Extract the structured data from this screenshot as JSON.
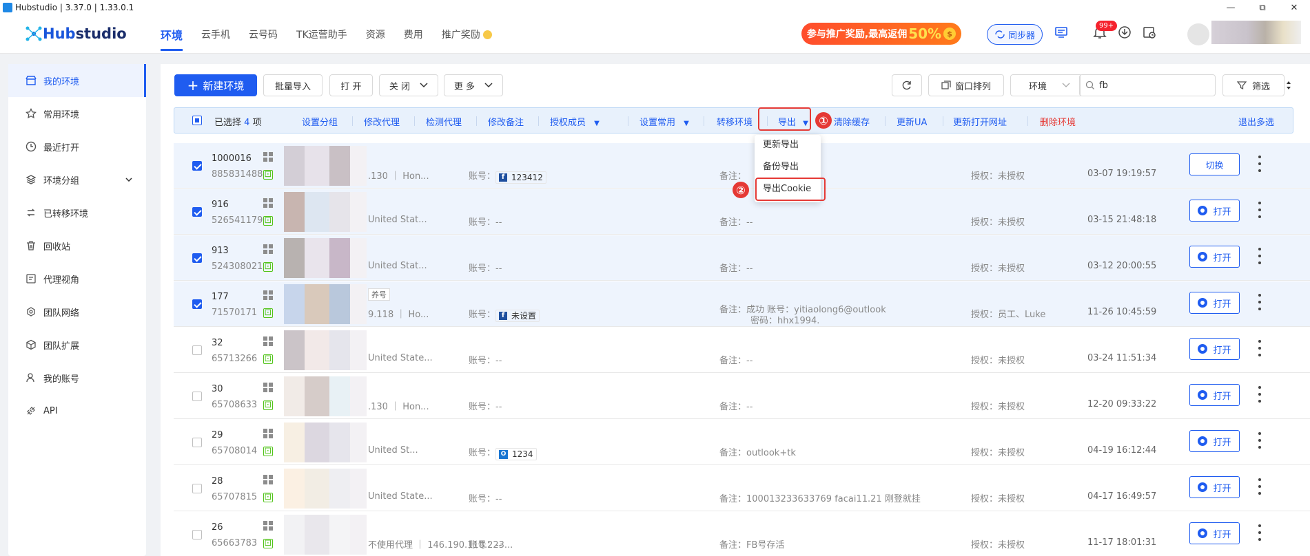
{
  "window": {
    "title": "Hubstudio | 3.37.0 | 1.33.0.1",
    "controls": [
      "—",
      "⧉",
      "✕"
    ]
  },
  "header": {
    "logo": {
      "hub": "Hub",
      "studio": "studio"
    },
    "nav": [
      "环境",
      "云手机",
      "云号码",
      "TK运营助手",
      "资源",
      "费用",
      "推广奖励"
    ],
    "promo": {
      "text": "参与推广奖励,最高返佣",
      "highlight": "50%",
      "coin": "$"
    },
    "sync_label": "同步器",
    "notif_badge": "99+"
  },
  "sidebar": {
    "items": [
      {
        "label": "我的环境",
        "icon": "store-icon"
      },
      {
        "label": "常用环境",
        "icon": "star-icon"
      },
      {
        "label": "最近打开",
        "icon": "clock-icon"
      },
      {
        "label": "环境分组",
        "icon": "layers-icon"
      },
      {
        "label": "已转移环境",
        "icon": "transfer-icon"
      },
      {
        "label": "回收站",
        "icon": "trash-icon"
      },
      {
        "label": "代理视角",
        "icon": "proxy-icon"
      },
      {
        "label": "团队网络",
        "icon": "network-icon"
      },
      {
        "label": "团队扩展",
        "icon": "extension-icon"
      },
      {
        "label": "我的账号",
        "icon": "user-icon"
      },
      {
        "label": "API",
        "icon": "api-icon"
      }
    ]
  },
  "toolbar": {
    "new_env": "新建环境",
    "batch_import": "批量导入",
    "open": "打 开",
    "close": "关 闭",
    "more": "更 多",
    "window_arrange": "窗口排列",
    "env_select": "环境",
    "search_value": "fb",
    "filter": "筛选"
  },
  "selection_bar": {
    "selected_prefix": "已选择",
    "selected_count": "4",
    "selected_suffix": "项",
    "actions": [
      "设置分组",
      "修改代理",
      "检测代理",
      "修改备注",
      "授权成员",
      "设置常用",
      "转移环境",
      "导出",
      "清除缓存",
      "更新UA",
      "更新打开网址",
      "删除环境",
      "退出多选"
    ]
  },
  "export_menu": {
    "items": [
      "更新导出",
      "备份导出",
      "导出Cookie"
    ]
  },
  "annotations": {
    "step1": "①",
    "step2": "②"
  },
  "rows": [
    {
      "id": "1000016",
      "sub": "885831488",
      "ip": ".130 ｜ Hon...",
      "acct_label": "账号：",
      "acct": "123412",
      "acct_type": "fb",
      "note": "备注：",
      "auth": "授权：未授权",
      "time": "03-07 19:19:57",
      "action": "切换",
      "checked": true
    },
    {
      "id": "916",
      "sub": "526541179",
      "ip": "United Stat...",
      "acct_label": "账号：",
      "acct": "--",
      "note": "备注：--",
      "auth": "授权：未授权",
      "time": "03-15 21:48:18",
      "action": "打开",
      "checked": true
    },
    {
      "id": "913",
      "sub": "524308021",
      "ip": "United Stat...",
      "acct_label": "账号：",
      "acct": "--",
      "note": "备注：--",
      "auth": "授权：未授权",
      "time": "03-12 20:00:55",
      "action": "打开",
      "checked": true
    },
    {
      "id": "177",
      "sub": "71570171",
      "ip": "9.118 ｜ Ho...",
      "tag": "养号",
      "acct_label": "账号：",
      "acct": "未设置",
      "acct_type": "fb",
      "note": "备注：成功 账号：yitiaolong6@outlook",
      "note2": "密码：hhx1994.",
      "auth": "授权：员工、Luke",
      "time": "11-26 10:45:59",
      "action": "打开",
      "checked": true
    },
    {
      "id": "32",
      "sub": "65713266",
      "ip": "United State...",
      "acct_label": "账号：",
      "acct": "--",
      "note": "备注：--",
      "auth": "授权：未授权",
      "time": "03-24 11:51:34",
      "action": "打开",
      "checked": false
    },
    {
      "id": "30",
      "sub": "65708633",
      "ip": ".130 ｜ Hon...",
      "acct_label": "账号：",
      "acct": "--",
      "note": "备注：--",
      "auth": "授权：未授权",
      "time": "12-20 09:33:22",
      "action": "打开",
      "checked": false
    },
    {
      "id": "29",
      "sub": "65708014",
      "ip": "United St...",
      "acct_label": "账号：",
      "acct": "1234",
      "acct_type": "outlook",
      "note": "备注：outlook+tk",
      "auth": "授权：未授权",
      "time": "04-19 16:12:44",
      "action": "打开",
      "checked": false
    },
    {
      "id": "28",
      "sub": "65707815",
      "ip": "United State...",
      "acct_label": "账号：",
      "acct": "--",
      "note": "备注：100013233633769 facai11.21 刚登就挂",
      "auth": "授权：未授权",
      "time": "04-17 16:49:57",
      "action": "打开",
      "checked": false
    },
    {
      "id": "26",
      "sub": "65663783",
      "ip": "不使用代理 ｜ 146.190.118.223...",
      "acct_label": "账号：",
      "acct": "--",
      "note": "备注：FB号存活",
      "auth": "授权：未授权",
      "time": "11-17 18:01:31",
      "action": "打开",
      "checked": false
    }
  ],
  "colors": {
    "primary": "#1f5cf0",
    "danger": "#e53935",
    "selected_row": "#eef4fd"
  }
}
